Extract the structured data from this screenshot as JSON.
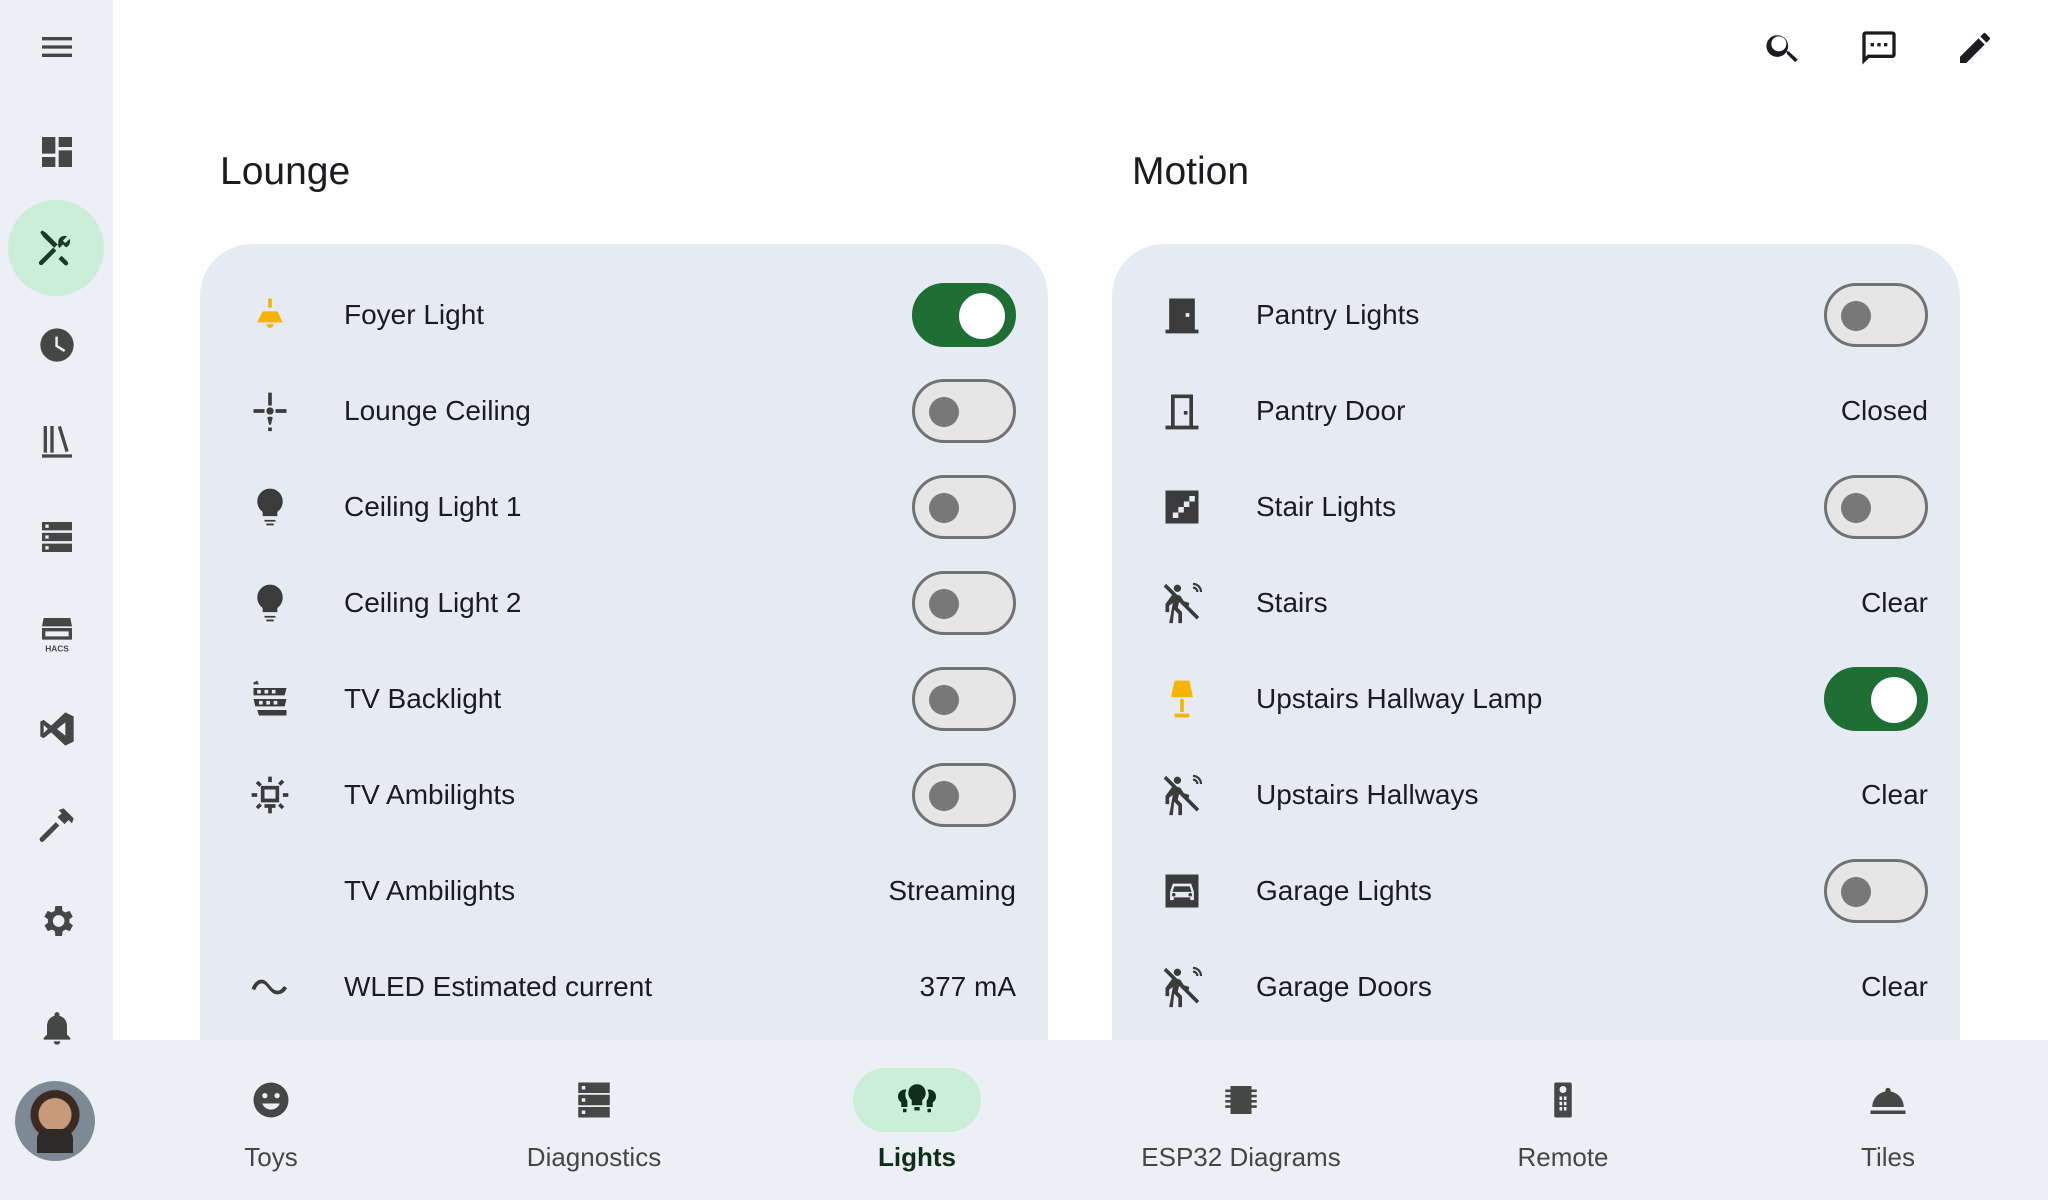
{
  "sidebar": {
    "items": [
      {
        "icon": "menu-icon"
      },
      {
        "icon": "dashboard-icon"
      },
      {
        "icon": "tools-icon",
        "active": true
      },
      {
        "icon": "history-clock-icon"
      },
      {
        "icon": "library-icon"
      },
      {
        "icon": "server-icon"
      },
      {
        "icon": "hacs-store-icon",
        "badge": "HACS"
      },
      {
        "icon": "vscode-icon"
      },
      {
        "icon": "hammer-icon"
      },
      {
        "icon": "gear-icon"
      },
      {
        "icon": "bell-icon"
      }
    ],
    "active_color": "#cbeed6"
  },
  "top_actions": [
    "search-icon",
    "assist-chat-icon",
    "edit-pencil-icon"
  ],
  "sections": [
    {
      "title": "Lounge",
      "rows": [
        {
          "label": "Foyer Light",
          "icon": "ceiling-light-icon",
          "icon_color": "#f4b400",
          "toggle": true
        },
        {
          "label": "Lounge Ceiling",
          "icon": "ceiling-fan-icon",
          "toggle": false
        },
        {
          "label": "Ceiling Light 1",
          "icon": "lightbulb-icon",
          "toggle": false
        },
        {
          "label": "Ceiling Light 2",
          "icon": "lightbulb-icon",
          "toggle": false
        },
        {
          "label": "TV Backlight",
          "icon": "led-strip-icon",
          "toggle": false
        },
        {
          "label": "TV Ambilights",
          "icon": "tv-ambient-icon",
          "toggle": false
        },
        {
          "label": "TV Ambilights",
          "icon": "",
          "value": "Streaming"
        },
        {
          "label": "WLED Estimated current",
          "icon": "current-ac-icon",
          "value": "377 mA"
        }
      ]
    },
    {
      "title": "Motion",
      "rows": [
        {
          "label": "Pantry Lights",
          "icon": "door-light-icon",
          "toggle": false
        },
        {
          "label": "Pantry Door",
          "icon": "door-closed-icon",
          "value": "Closed"
        },
        {
          "label": "Stair Lights",
          "icon": "stairs-icon",
          "toggle": false
        },
        {
          "label": "Stairs",
          "icon": "motion-sensor-off-icon",
          "value": "Clear"
        },
        {
          "label": "Upstairs Hallway Lamp",
          "icon": "floor-lamp-icon",
          "icon_color": "#f4b400",
          "toggle": true
        },
        {
          "label": "Upstairs Hallways",
          "icon": "motion-sensor-off-icon",
          "value": "Clear"
        },
        {
          "label": "Garage Lights",
          "icon": "garage-car-icon",
          "toggle": false
        },
        {
          "label": "Garage Doors",
          "icon": "motion-sensor-off-icon",
          "value": "Clear"
        }
      ]
    }
  ],
  "bottom_nav": [
    {
      "label": "Toys",
      "icon": "emoticon-icon"
    },
    {
      "label": "Diagnostics",
      "icon": "server-icon"
    },
    {
      "label": "Lights",
      "icon": "lightbulb-group-icon",
      "active": true
    },
    {
      "label": "ESP32 Diagrams",
      "icon": "chip-icon"
    },
    {
      "label": "Remote",
      "icon": "remote-icon"
    },
    {
      "label": "Tiles",
      "icon": "room-service-icon"
    }
  ],
  "colors": {
    "toggle_on": "#1f6f34",
    "card_bg": "#e6ebf3",
    "nav_active_pill": "#cbeed6",
    "light_on_icon": "#f4b400"
  }
}
